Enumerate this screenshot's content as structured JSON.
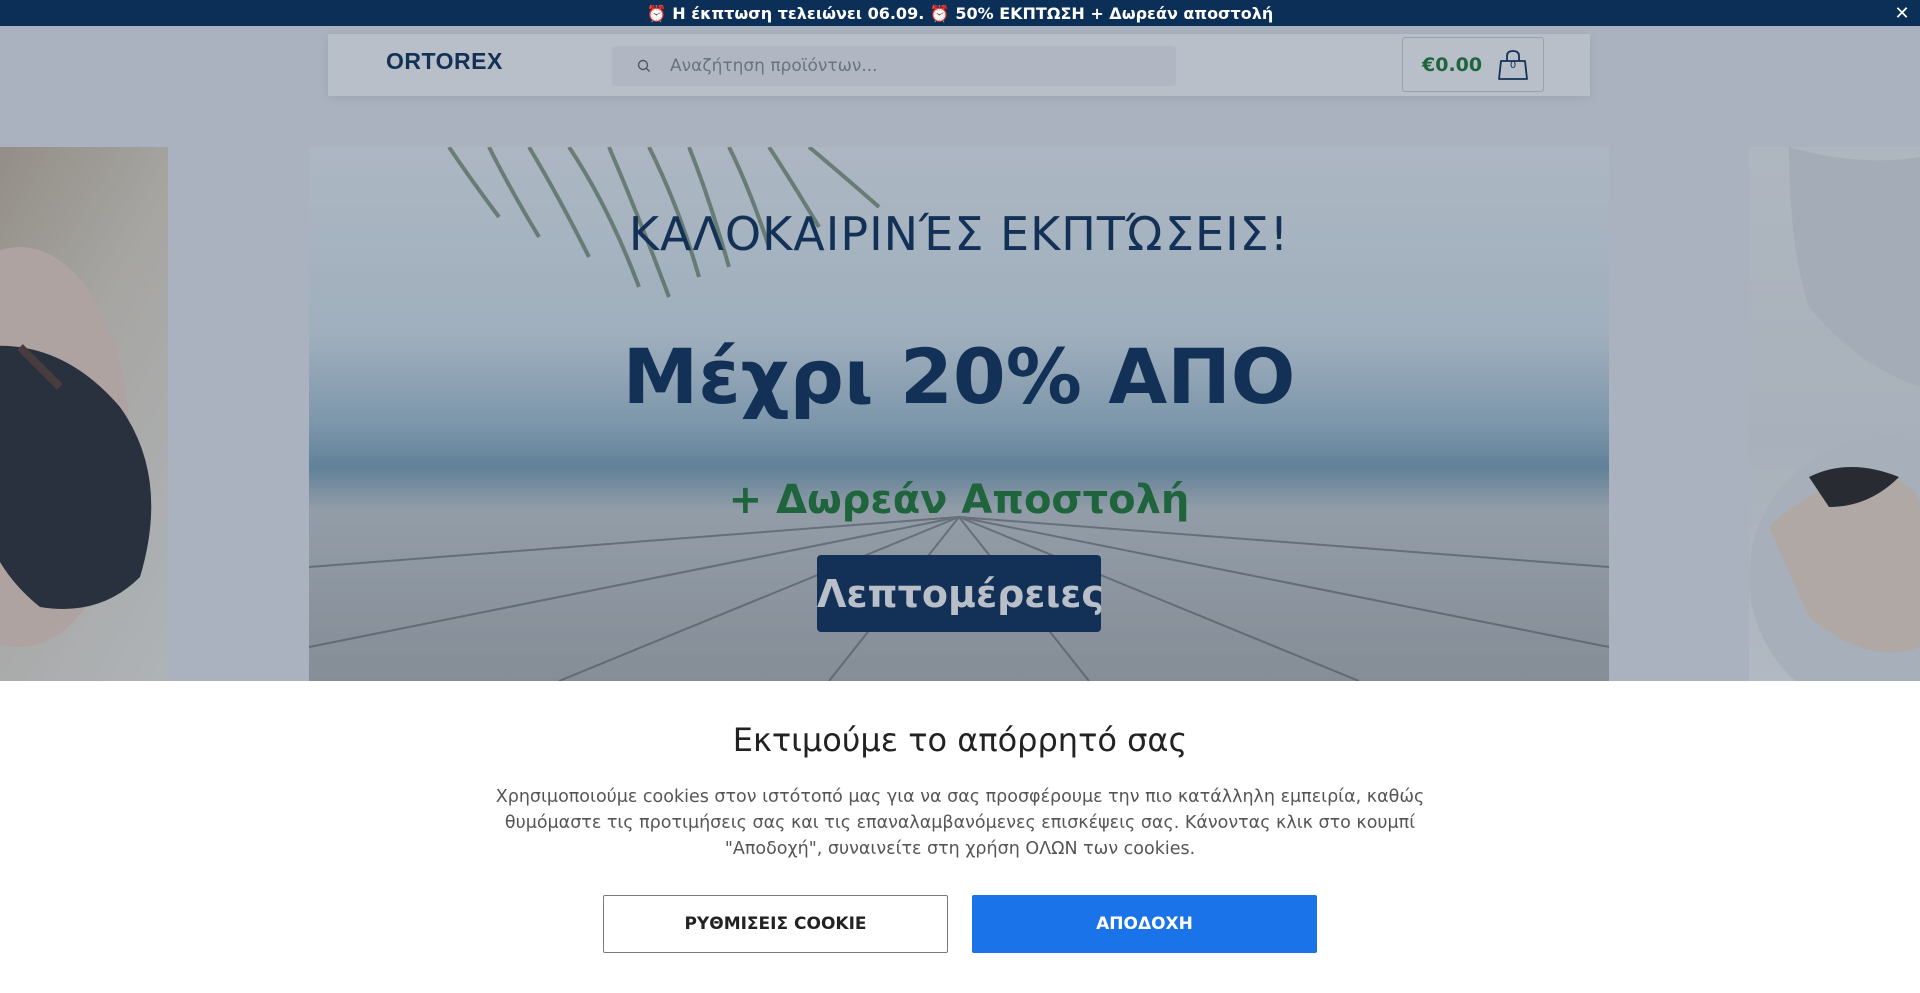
{
  "announcement": {
    "text": "⏰ Η έκπτωση τελειώνει 06.09. ⏰ 50% ΕΚΠΤΩΣΗ + Δωρεάν αποστολή",
    "close_glyph": "✕"
  },
  "header": {
    "logo": "ORTOREX",
    "search": {
      "placeholder": "Αναζήτηση προϊόντων..."
    },
    "cart": {
      "total": "€0.00",
      "count": "0"
    }
  },
  "hero": {
    "title": "ΚΑΛΟΚΑΙΡΙΝΈΣ ΕΚΠΤΏΣΕΙΣ!",
    "headline": "Μέχρι 20% ΑΠΟ",
    "subtitle": "+ Δωρεάν Αποστολή",
    "cta": "Λεπτομέρειες"
  },
  "cookie": {
    "heading": "Εκτιμούμε το απόρρητό σας",
    "body": "Χρησιμοποιούμε cookies στον ιστότοπό μας για να σας προσφέρουμε την πιο κατάλληλη εμπειρία, καθώς θυμόμαστε τις προτιμήσεις σας και τις επαναλαμβανόμενες επισκέψεις σας. Κάνοντας κλικ στο κουμπί \"Αποδοχή\", συναινείτε στη χρήση ΟΛΩΝ των cookies.",
    "settings_label": "ΡΥΘΜΙΣΕΙΣ COOKIE",
    "accept_label": "ΑΠΟΔΟΧΗ"
  },
  "colors": {
    "brand_navy": "#0c2f57",
    "brand_green": "#1e7a31",
    "accept_blue": "#1a73e8"
  },
  "icons": [
    "close-icon",
    "search-icon",
    "shopping-bag-icon"
  ]
}
